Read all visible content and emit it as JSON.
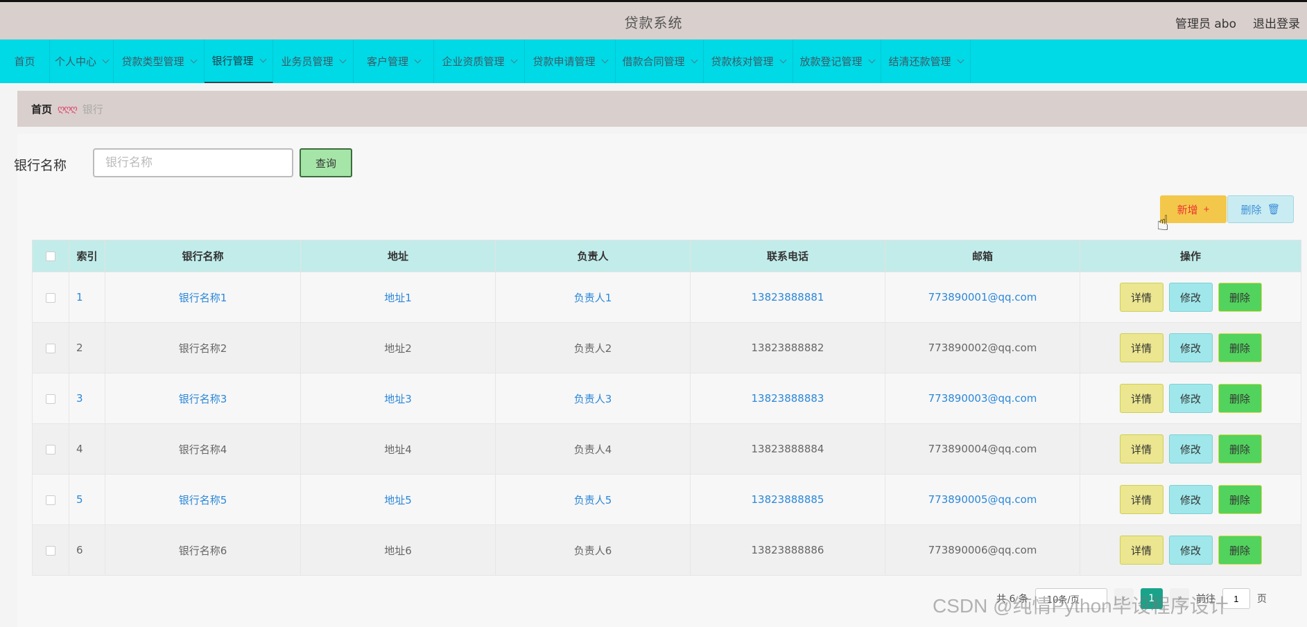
{
  "header": {
    "title": "贷款系统",
    "user_label": "管理员 abo",
    "logout_label": "退出登录"
  },
  "nav": {
    "items": [
      {
        "label": "首页",
        "dropdown": false
      },
      {
        "label": "个人中心",
        "dropdown": true
      },
      {
        "label": "贷款类型管理",
        "dropdown": true
      },
      {
        "label": "银行管理",
        "dropdown": true,
        "active": true
      },
      {
        "label": "业务员管理",
        "dropdown": true
      },
      {
        "label": "客户管理",
        "dropdown": true
      },
      {
        "label": "企业资质管理",
        "dropdown": true
      },
      {
        "label": "贷款申请管理",
        "dropdown": true
      },
      {
        "label": "借款合同管理",
        "dropdown": true
      },
      {
        "label": "贷款核对管理",
        "dropdown": true
      },
      {
        "label": "放款登记管理",
        "dropdown": true
      },
      {
        "label": "结清还款管理",
        "dropdown": true
      }
    ]
  },
  "breadcrumb": {
    "home": "首页",
    "separator": "ღღღ",
    "current": "银行"
  },
  "search": {
    "label": "银行名称",
    "placeholder": "银行名称",
    "value": "",
    "button_label": "查询"
  },
  "toolbar": {
    "add_label": "新增",
    "add_icon": "+",
    "delete_label": "删除",
    "delete_icon": "🗑"
  },
  "table": {
    "columns": [
      "索引",
      "银行名称",
      "地址",
      "负责人",
      "联系电话",
      "邮箱",
      "操作"
    ],
    "rows": [
      {
        "index": "1",
        "name": "银行名称1",
        "address": "地址1",
        "manager": "负责人1",
        "phone": "13823888881",
        "email": "773890001@qq.com"
      },
      {
        "index": "2",
        "name": "银行名称2",
        "address": "地址2",
        "manager": "负责人2",
        "phone": "13823888882",
        "email": "773890002@qq.com"
      },
      {
        "index": "3",
        "name": "银行名称3",
        "address": "地址3",
        "manager": "负责人3",
        "phone": "13823888883",
        "email": "773890003@qq.com"
      },
      {
        "index": "4",
        "name": "银行名称4",
        "address": "地址4",
        "manager": "负责人4",
        "phone": "13823888884",
        "email": "773890004@qq.com"
      },
      {
        "index": "5",
        "name": "银行名称5",
        "address": "地址5",
        "manager": "负责人5",
        "phone": "13823888885",
        "email": "773890005@qq.com"
      },
      {
        "index": "6",
        "name": "银行名称6",
        "address": "地址6",
        "manager": "负责人6",
        "phone": "13823888886",
        "email": "773890006@qq.com"
      }
    ],
    "actions": {
      "detail": "详情",
      "edit": "修改",
      "delete": "删除"
    }
  },
  "pagination": {
    "total_text": "共 6 条",
    "page_size": "10条/页",
    "current_page": "1",
    "goto_prefix": "前往",
    "goto_value": "1",
    "goto_suffix": "页"
  },
  "watermark": "CSDN @纯情Python毕设程序设计",
  "colors": {
    "header_bg": "#d9cfcc",
    "nav_bg": "#00d9e6",
    "table_header_bg": "#c2ecea",
    "link_blue": "#2b87d9",
    "add_button": "#f3c84a",
    "detail_button": "#ebe68f",
    "edit_button": "#9fe7ea",
    "delete_button": "#52d35e",
    "pager_active": "#19a38a"
  }
}
